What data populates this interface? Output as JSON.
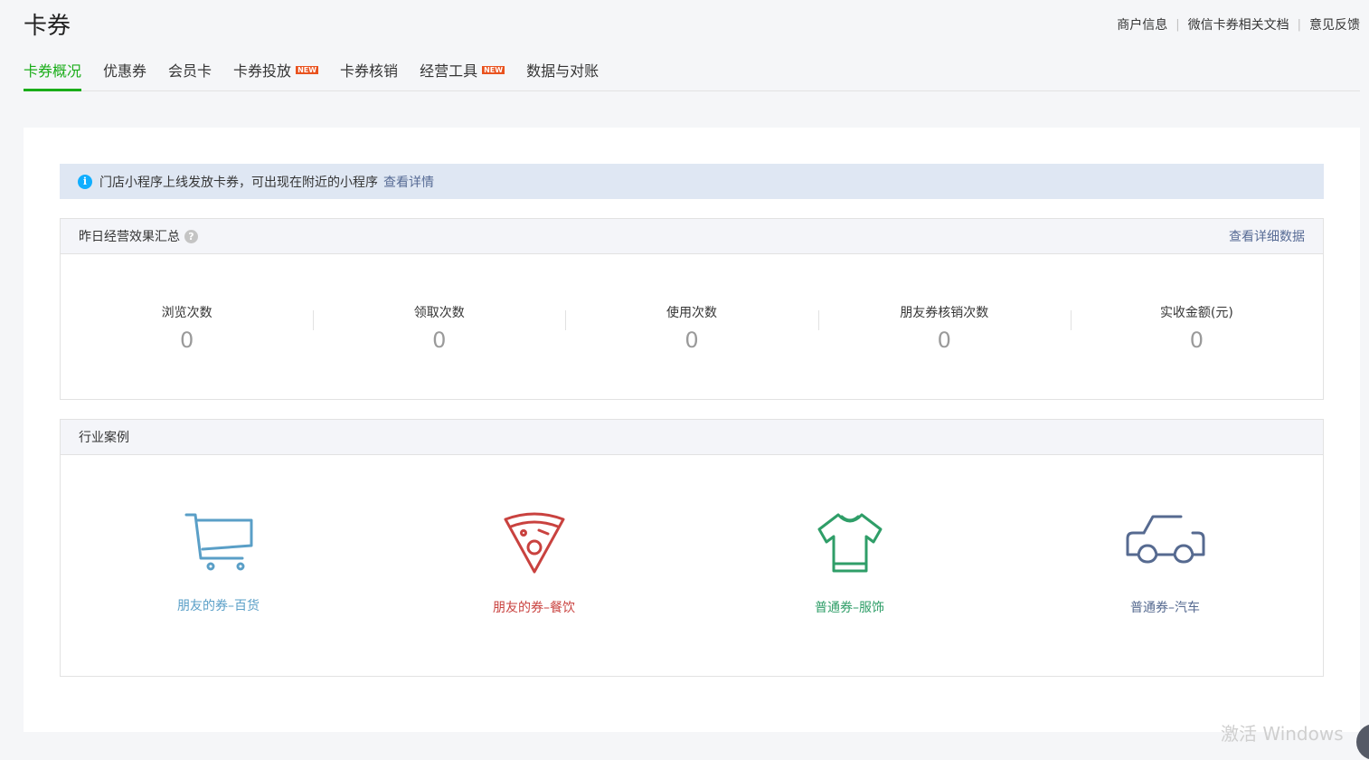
{
  "header": {
    "title": "卡券",
    "links": [
      "商户信息",
      "微信卡券相关文档",
      "意见反馈"
    ]
  },
  "tabs": [
    {
      "label": "卡券概况",
      "active": true,
      "badge": ""
    },
    {
      "label": "优惠券",
      "active": false,
      "badge": ""
    },
    {
      "label": "会员卡",
      "active": false,
      "badge": ""
    },
    {
      "label": "卡券投放",
      "active": false,
      "badge": "NEW"
    },
    {
      "label": "卡券核销",
      "active": false,
      "badge": ""
    },
    {
      "label": "经营工具",
      "active": false,
      "badge": "NEW"
    },
    {
      "label": "数据与对账",
      "active": false,
      "badge": ""
    }
  ],
  "notice": {
    "icon": "info-icon",
    "text": "门店小程序上线发放卡券，可出现在附近的小程序",
    "link": "查看详情"
  },
  "summary": {
    "title": "昨日经营效果汇总",
    "help_icon": "?",
    "link": "查看详细数据",
    "stats": [
      {
        "label": "浏览次数",
        "value": "0"
      },
      {
        "label": "领取次数",
        "value": "0"
      },
      {
        "label": "使用次数",
        "value": "0"
      },
      {
        "label": "朋友券核销次数",
        "value": "0"
      },
      {
        "label": "实收金额(元)",
        "value": "0"
      }
    ]
  },
  "cases": {
    "title": "行业案例",
    "items": [
      {
        "label": "朋友的券–百货",
        "icon": "cart-icon",
        "color": "#5a9fc7"
      },
      {
        "label": "朋友的券–餐饮",
        "icon": "pizza-icon",
        "color": "#c9423f"
      },
      {
        "label": "普通券–服饰",
        "icon": "tshirt-icon",
        "color": "#2f9e68"
      },
      {
        "label": "普通券–汽车",
        "icon": "car-icon",
        "color": "#566a90"
      }
    ]
  },
  "colors": {
    "accent": "#1aad19",
    "link": "#576b95",
    "badge": "#e9521e"
  },
  "watermark": "激活 Windows"
}
